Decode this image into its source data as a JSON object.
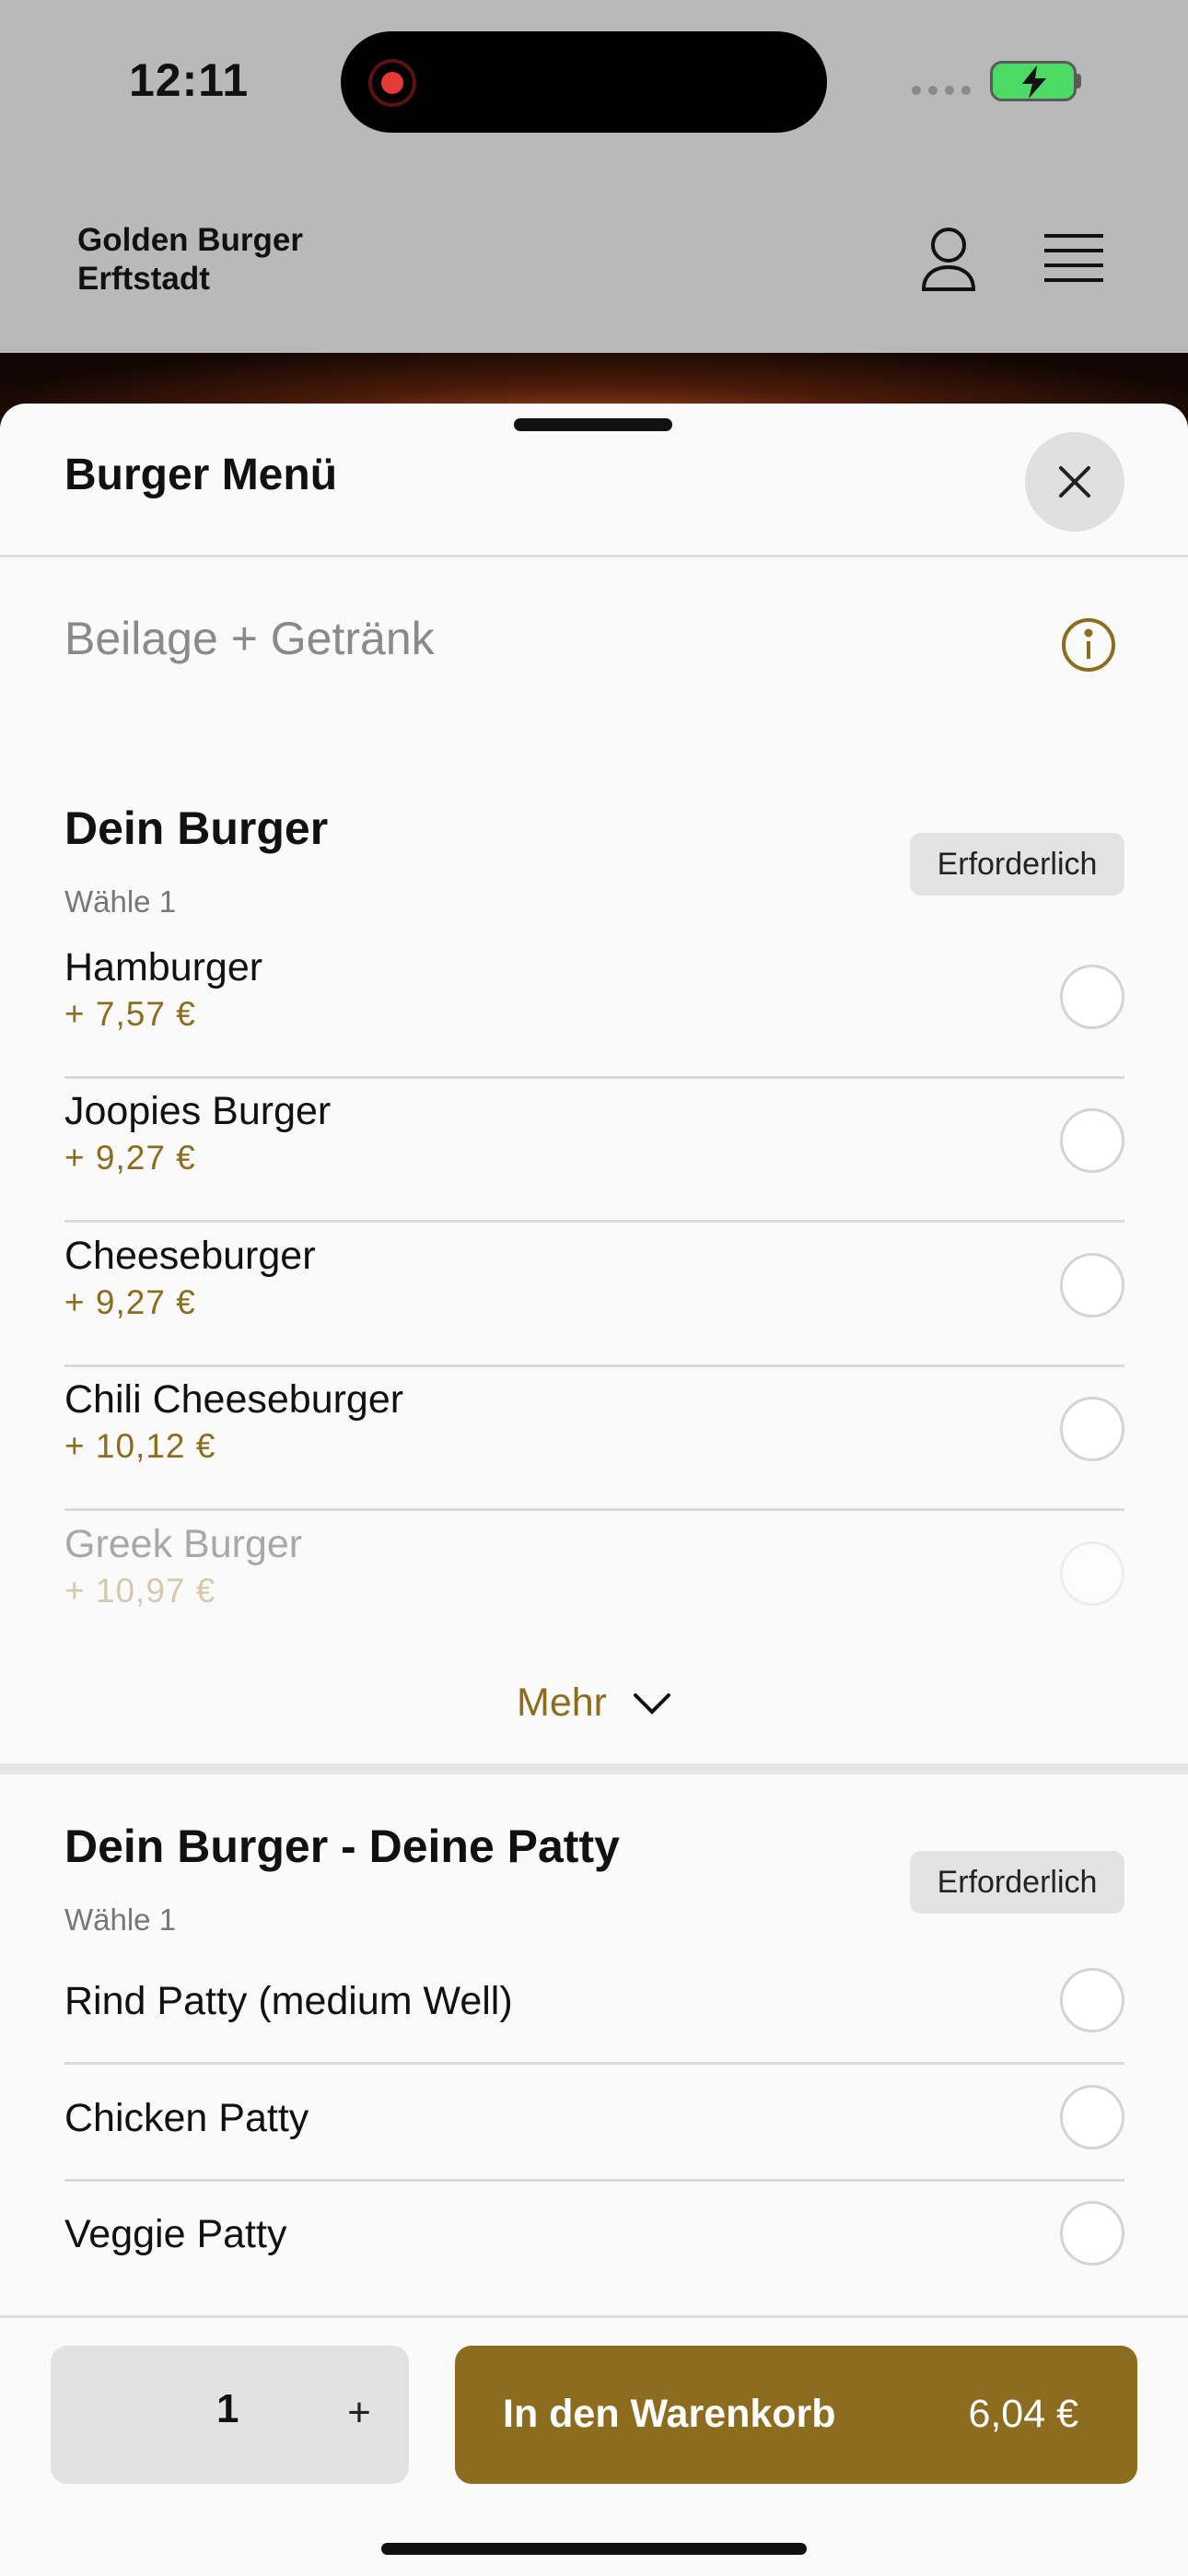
{
  "status": {
    "time": "12:11"
  },
  "header": {
    "brand": "Golden Burger\nErftstadt"
  },
  "sheet": {
    "title": "Burger Menü",
    "description": "Beilage + Getränk"
  },
  "groups": [
    {
      "title": "Dein Burger",
      "subtitle": "Wähle 1",
      "badge": "Erforderlich",
      "options": [
        {
          "name": "Hamburger",
          "price": "+ 7,57 €"
        },
        {
          "name": "Joopies Burger",
          "price": "+ 9,27 €"
        },
        {
          "name": "Cheeseburger",
          "price": "+ 9,27 €"
        },
        {
          "name": "Chili Cheeseburger",
          "price": "+ 10,12 €"
        },
        {
          "name": "Greek Burger",
          "price": "+ 10,97 €"
        }
      ],
      "more_label": "Mehr"
    },
    {
      "title": "Dein Burger - Deine Patty",
      "subtitle": "Wähle 1",
      "badge": "Erforderlich",
      "options": [
        {
          "name": "Rind Patty (medium Well)"
        },
        {
          "name": "Chicken Patty"
        },
        {
          "name": "Veggie Patty"
        }
      ]
    }
  ],
  "footer": {
    "quantity": "1",
    "plus": "+",
    "cart_label": "In den Warenkorb",
    "cart_price": "6,04 €"
  },
  "colors": {
    "accent": "#8c6d1f",
    "battery": "#4cd964",
    "recording": "#e53935"
  }
}
